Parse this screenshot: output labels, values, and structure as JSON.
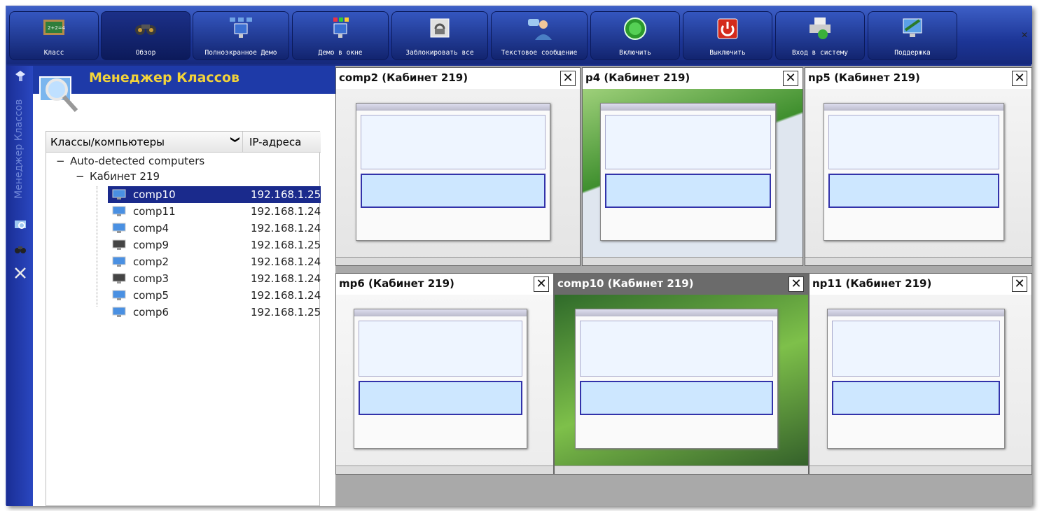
{
  "toolbar": {
    "buttons": [
      {
        "label": "Класс",
        "icon": "classroom-board-icon"
      },
      {
        "label": "Обзор",
        "icon": "binoculars-icon"
      },
      {
        "label": "Полноэкранное Демо",
        "icon": "fullscreen-demo-icon"
      },
      {
        "label": "Демо в окне",
        "icon": "window-demo-icon"
      },
      {
        "label": "Заблокировать все",
        "icon": "lock-icon"
      },
      {
        "label": "Текстовое сообщение",
        "icon": "text-message-icon"
      },
      {
        "label": "Включить",
        "icon": "power-on-icon"
      },
      {
        "label": "Выключить",
        "icon": "power-off-icon"
      },
      {
        "label": "Вход в систему",
        "icon": "login-icon"
      },
      {
        "label": "Поддержка",
        "icon": "support-icon"
      }
    ]
  },
  "sidebar": {
    "vertical_label": "Менеджер Классов"
  },
  "panel": {
    "title": "Менеджер Классов",
    "columns": {
      "name": "Классы/компьютеры",
      "ip": "IP-адреса"
    },
    "group": "Auto-detected computers",
    "room": "Кабинет 219",
    "computers": [
      {
        "name": "comp10",
        "ip": "192.168.1.25",
        "selected": true,
        "online": true
      },
      {
        "name": "comp11",
        "ip": "192.168.1.24",
        "selected": false,
        "online": true
      },
      {
        "name": "comp4",
        "ip": "192.168.1.24",
        "selected": false,
        "online": true
      },
      {
        "name": "comp9",
        "ip": "192.168.1.25",
        "selected": false,
        "online": false
      },
      {
        "name": "comp2",
        "ip": "192.168.1.24",
        "selected": false,
        "online": true
      },
      {
        "name": "comp3",
        "ip": "192.168.1.24",
        "selected": false,
        "online": false
      },
      {
        "name": "comp5",
        "ip": "192.168.1.24",
        "selected": false,
        "online": true
      },
      {
        "name": "comp6",
        "ip": "192.168.1.25",
        "selected": false,
        "online": true
      }
    ]
  },
  "viewer": {
    "tiles": [
      {
        "title": "comp2 (Кабинет 219)",
        "active": false
      },
      {
        "title": "p4 (Кабинет 219)",
        "active": false
      },
      {
        "title": "np5 (Кабинет 219)",
        "active": false
      },
      {
        "title": "mp6 (Кабинет 219)",
        "active": false
      },
      {
        "title": "comp10 (Кабинет 219)",
        "active": true
      },
      {
        "title": "np11 (Кабинет 219)",
        "active": false
      }
    ]
  },
  "colors": {
    "toolbar": "#1c3596",
    "panel_title": "#f2d33a",
    "selection": "#1a2a8c"
  }
}
